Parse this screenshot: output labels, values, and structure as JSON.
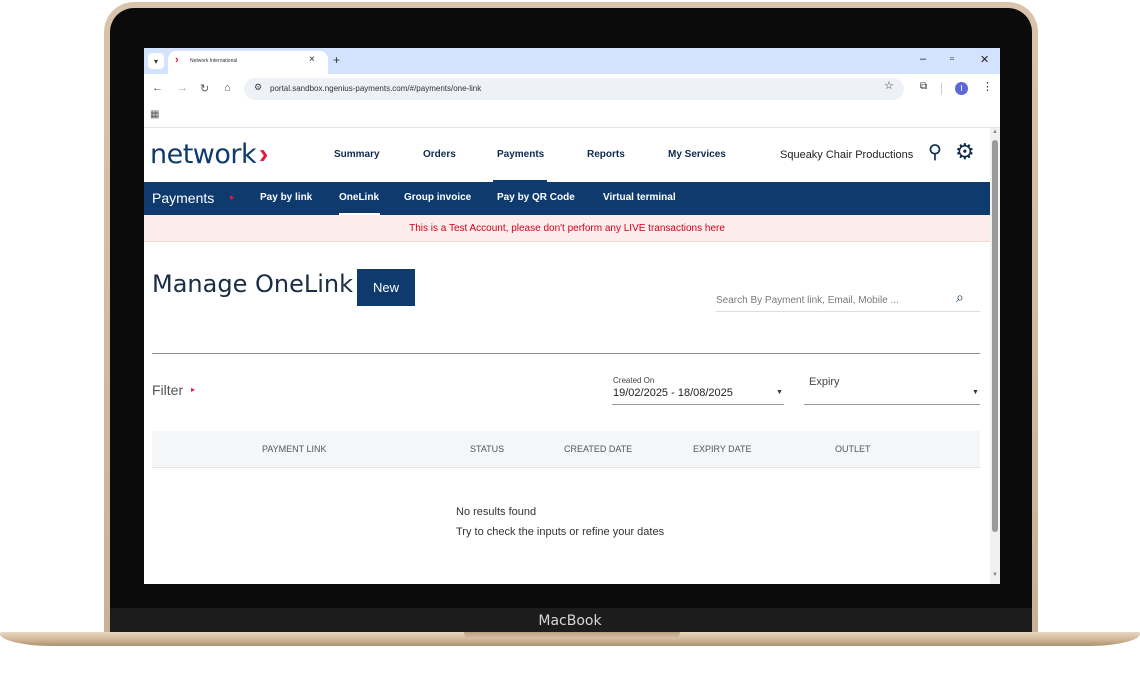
{
  "device": {
    "label": "MacBook"
  },
  "browser": {
    "tab_title": "Network International",
    "tab_close": "×",
    "new_tab": "+",
    "url": "portal.sandbox.ngenius-payments.com/#/payments/one-link",
    "profile_initial": "I"
  },
  "header": {
    "logo_text": "network",
    "nav": [
      "Summary",
      "Orders",
      "Payments",
      "Reports",
      "My Services"
    ],
    "active_nav": "Payments",
    "merchant_name": "Squeaky Chair Productions"
  },
  "subnav": {
    "section_title": "Payments",
    "items": [
      "Pay by link",
      "OneLink",
      "Group invoice",
      "Pay by QR Code",
      "Virtual terminal"
    ],
    "active_item": "OneLink"
  },
  "banner": {
    "text": "This is a Test Account, please don't perform any LIVE transactions here"
  },
  "main": {
    "title": "Manage OneLink",
    "new_button": "New",
    "search_placeholder": "Search By Payment link, Email, Mobile ..."
  },
  "filter": {
    "label": "Filter",
    "created_on_caption": "Created On",
    "created_on_value": "19/02/2025 - 18/08/2025",
    "expiry_label": "Expiry"
  },
  "table": {
    "columns": [
      "PAYMENT LINK",
      "STATUS",
      "CREATED DATE",
      "EXPIRY DATE",
      "OUTLET"
    ]
  },
  "empty_state": {
    "title": "No results found",
    "hint": "Try to check the inputs or refine your dates"
  },
  "colors": {
    "brand_navy": "#0e3a6e",
    "brand_red": "#e4173e",
    "banner_bg": "#fdecec",
    "banner_text": "#d0021b"
  }
}
